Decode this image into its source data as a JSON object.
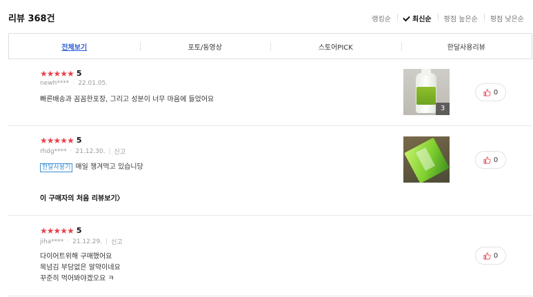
{
  "header": {
    "title": "리뷰 368건",
    "sort_options": [
      {
        "label": "랭킹순",
        "active": false
      },
      {
        "label": "최신순",
        "active": true
      },
      {
        "label": "평점 높은순",
        "active": false
      },
      {
        "label": "평점 낮은순",
        "active": false
      }
    ]
  },
  "tabs": [
    {
      "label": "전체보기",
      "active": true
    },
    {
      "label": "포토/동영상",
      "active": false
    },
    {
      "label": "스토어PICK",
      "active": false
    },
    {
      "label": "한달사용리뷰",
      "active": false
    }
  ],
  "reviews": [
    {
      "stars": 5,
      "score": "5",
      "user": "newh****",
      "date": "22.01.05.",
      "report": "",
      "badge": "",
      "lines": [
        "빠른배송과 꼼꼼한포장, 그리고 성분이 너무 마음에 들었어요"
      ],
      "photo_count": "3",
      "likes": "0"
    },
    {
      "stars": 5,
      "score": "5",
      "user": "rhdg****",
      "date": "21.12.30.",
      "report": "신고",
      "badge": "한달사용기",
      "lines": [
        "매일 챙겨먹고 있습니당"
      ],
      "first_review_link": "이 구매자의 처음 리뷰보기",
      "likes": "0"
    },
    {
      "stars": 5,
      "score": "5",
      "user": "jiha****",
      "date": "21.12.29.",
      "report": "신고",
      "badge": "",
      "lines": [
        "다이어트위해 구매했어요",
        "목넘김 부담없은 알약이네요",
        "꾸준히 먹어봐야겠오요 ㅋ"
      ],
      "likes": "0"
    }
  ],
  "colors": {
    "star": "#e6424d",
    "active_tab": "#2a5bd7",
    "badge": "#3b8fd4"
  },
  "icons": {
    "star": "star-icon",
    "like": "thumbs-up-icon",
    "check": "check-icon"
  }
}
